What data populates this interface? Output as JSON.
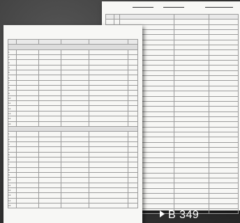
{
  "back_sheet": {
    "title": "",
    "page_number": "",
    "columns": [
      "",
      "",
      "",
      "",
      ""
    ],
    "row_count": 38
  },
  "front_sheet": {
    "title": "",
    "page_number": "",
    "columns": [
      "",
      "",
      "",
      "",
      "",
      ""
    ],
    "groups": [
      {
        "label": "",
        "rows": [
          "1",
          "2",
          "3",
          "4",
          "5",
          "6",
          "7",
          "8",
          "9",
          "10",
          "11",
          "12",
          "13",
          "14",
          "15"
        ]
      },
      {
        "label": "",
        "rows": [
          "1",
          "2",
          "3",
          "4",
          "5",
          "6",
          "7",
          "8",
          "9",
          "10",
          "11",
          "12",
          "13",
          "14",
          "15"
        ]
      }
    ]
  },
  "product_code": "B 349"
}
